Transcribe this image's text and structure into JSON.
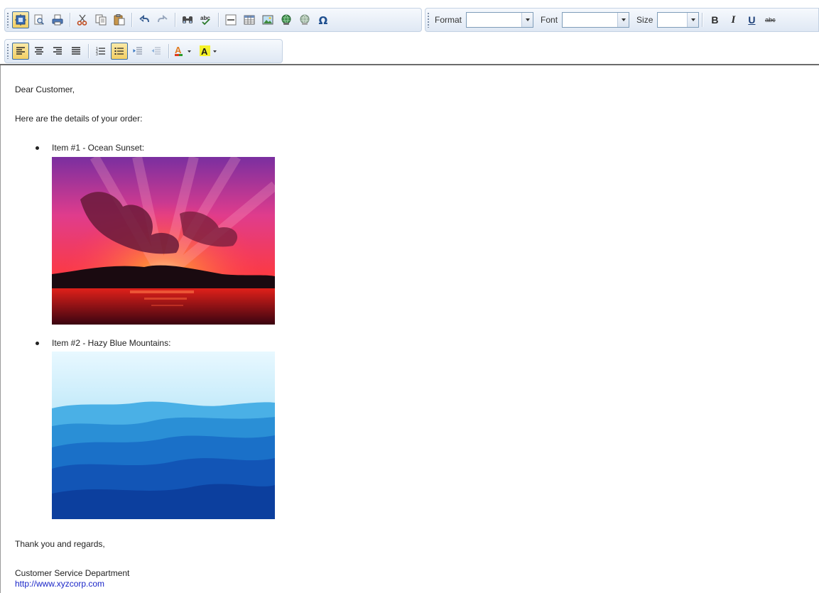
{
  "toolbar": {
    "row1": [
      {
        "name": "select-all-button",
        "icon": "select-all-icon",
        "active": true
      },
      {
        "name": "preview-button",
        "icon": "preview-icon"
      },
      {
        "name": "print-button",
        "icon": "print-icon"
      },
      {
        "name": "cut-button",
        "icon": "scissors-icon"
      },
      {
        "name": "copy-button",
        "icon": "copy-icon"
      },
      {
        "name": "paste-button",
        "icon": "paste-icon"
      },
      {
        "name": "undo-button",
        "icon": "undo-icon"
      },
      {
        "name": "redo-button",
        "icon": "redo-icon"
      },
      {
        "name": "find-button",
        "icon": "binoculars-icon"
      },
      {
        "name": "spellcheck-button",
        "icon": "spellcheck-icon"
      },
      {
        "name": "horizontal-rule-button",
        "icon": "horizontal-rule-icon"
      },
      {
        "name": "insert-table-button",
        "icon": "table-icon"
      },
      {
        "name": "insert-image-button",
        "icon": "image-icon"
      },
      {
        "name": "insert-link-button",
        "icon": "link-globe-icon"
      },
      {
        "name": "remove-link-button",
        "icon": "unlink-globe-icon"
      },
      {
        "name": "special-character-button",
        "icon": "omega-icon"
      }
    ],
    "format_label": "Format",
    "format_value": "",
    "font_label": "Font",
    "font_value": "",
    "size_label": "Size",
    "size_value": "",
    "bold_label": "B",
    "italic_label": "I",
    "underline_label": "U",
    "strike_label": "abc",
    "accent": "#3a6ea5"
  },
  "content": {
    "greeting": "Dear Customer,",
    "intro": "Here are the details of your order:",
    "items": [
      {
        "label": "Item #1 - Ocean Sunset:",
        "image": "ocean-sunset-image"
      },
      {
        "label": "Item #2 - Hazy Blue Mountains:",
        "image": "hazy-blue-mountains-image"
      }
    ],
    "closing": "Thank you and regards,",
    "signature": "Customer Service Department",
    "link": "http://www.xyzcorp.com",
    "link_color": "#1a26c8"
  }
}
